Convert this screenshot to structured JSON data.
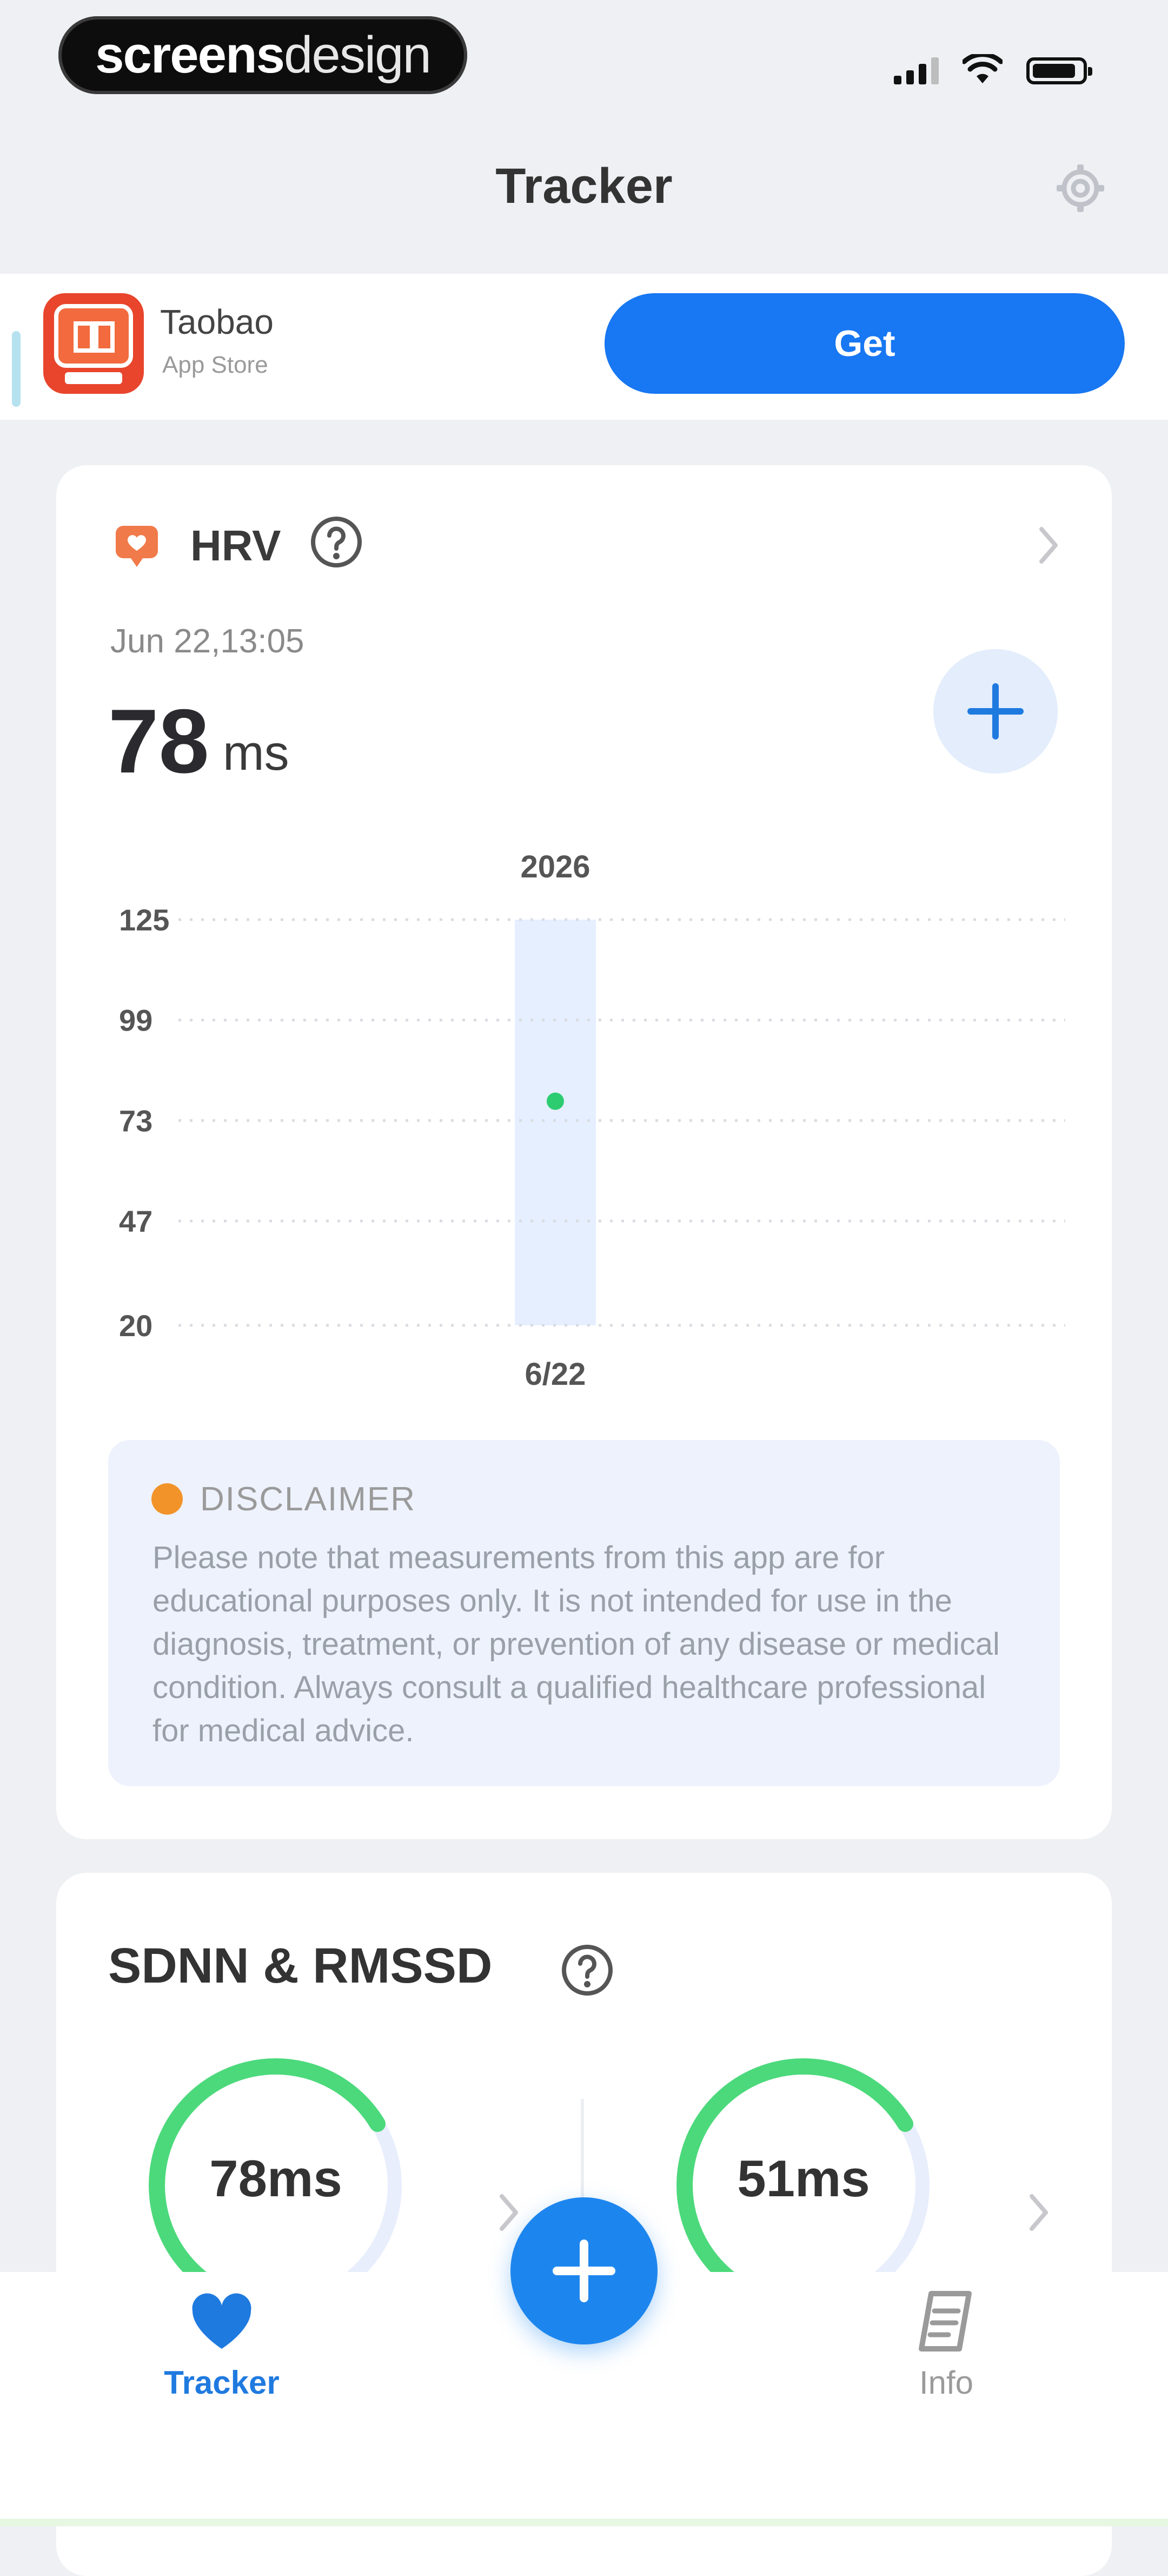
{
  "status_bar": {
    "brand_bold": "screens",
    "brand_light": "design"
  },
  "nav": {
    "title": "Tracker",
    "settings_icon": "gear-icon"
  },
  "ad": {
    "app_name": "Taobao",
    "store": "App Store",
    "cta": "Get"
  },
  "hrv_card": {
    "title": "HRV",
    "date": "Jun 22,13:05",
    "value": "78",
    "unit": "ms"
  },
  "chart_data": {
    "type": "scatter",
    "title": "2026",
    "xlabel": "",
    "ylabel": "",
    "categories": [
      "6/22"
    ],
    "y_ticks": [
      "125",
      "99",
      "73",
      "47",
      "20"
    ],
    "ylim": [
      20,
      125
    ],
    "grid": true,
    "series": [
      {
        "values": [
          78
        ],
        "color": "#2ecc71"
      }
    ],
    "highlight_color": "#e6efff"
  },
  "disclaimer": {
    "title": "DISCLAIMER",
    "text": "Please note that measurements from this app are for educational purposes only. It is not intended for use in the diagnosis, treatment, or prevention of any disease or medical condition. Always consult a qualified healthcare professional for medical advice."
  },
  "sdnn_card": {
    "title": "SDNN & RMSSD",
    "sdnn_value": "78ms",
    "rmssd_value": "51ms"
  },
  "tabbar": {
    "tracker_label": "Tracker",
    "info_label": "Info"
  },
  "colors": {
    "accent": "#1f7ae0",
    "ring_green": "#4cd97b",
    "ring_track": "#e8eefc",
    "hrv_icon": "#f07a4a"
  }
}
